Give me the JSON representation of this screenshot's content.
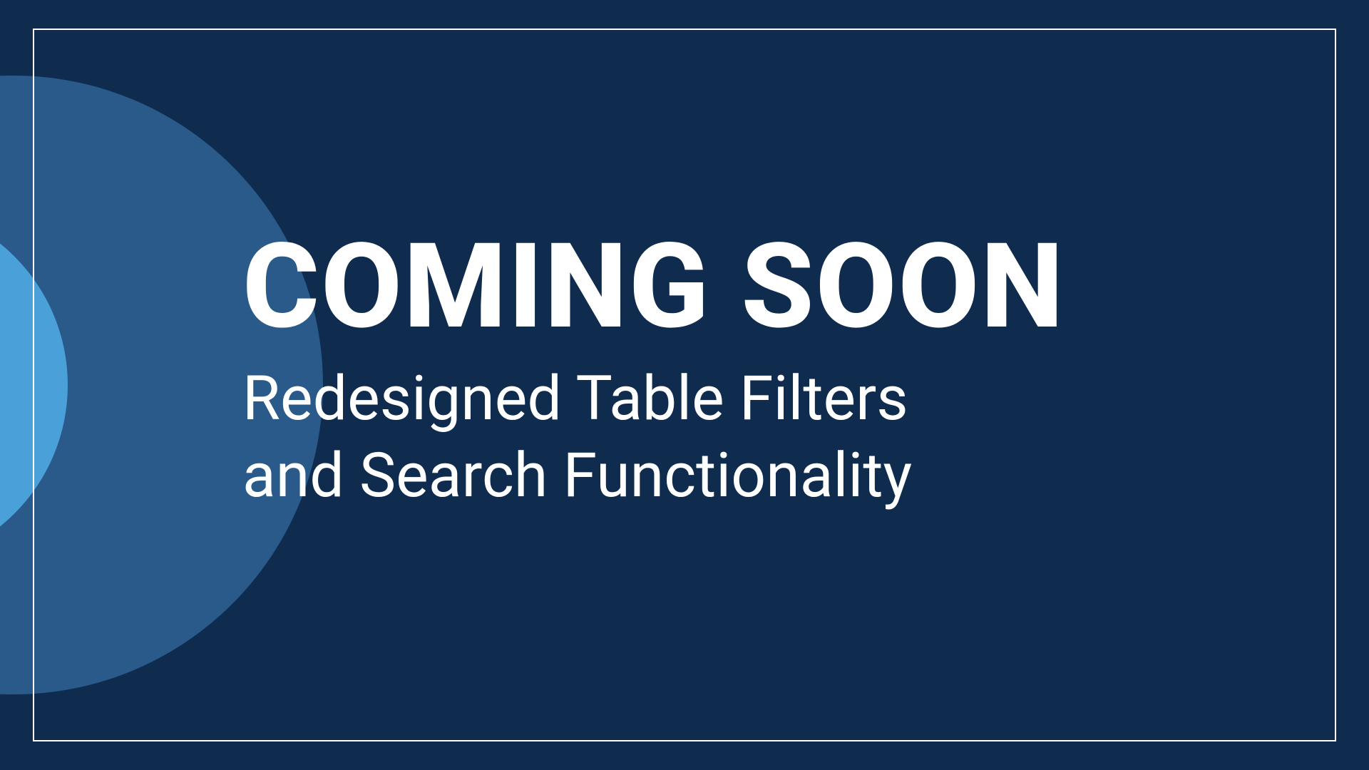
{
  "announcement": {
    "heading": "COMING SOON",
    "subheading_line1": "Redesigned Table Filters",
    "subheading_line2": "and Search Functionality"
  },
  "colors": {
    "background": "#0f2c4f",
    "circle_large": "#2a5a8a",
    "circle_small": "#4aa0d9",
    "text": "#ffffff",
    "border": "#ffffff"
  }
}
